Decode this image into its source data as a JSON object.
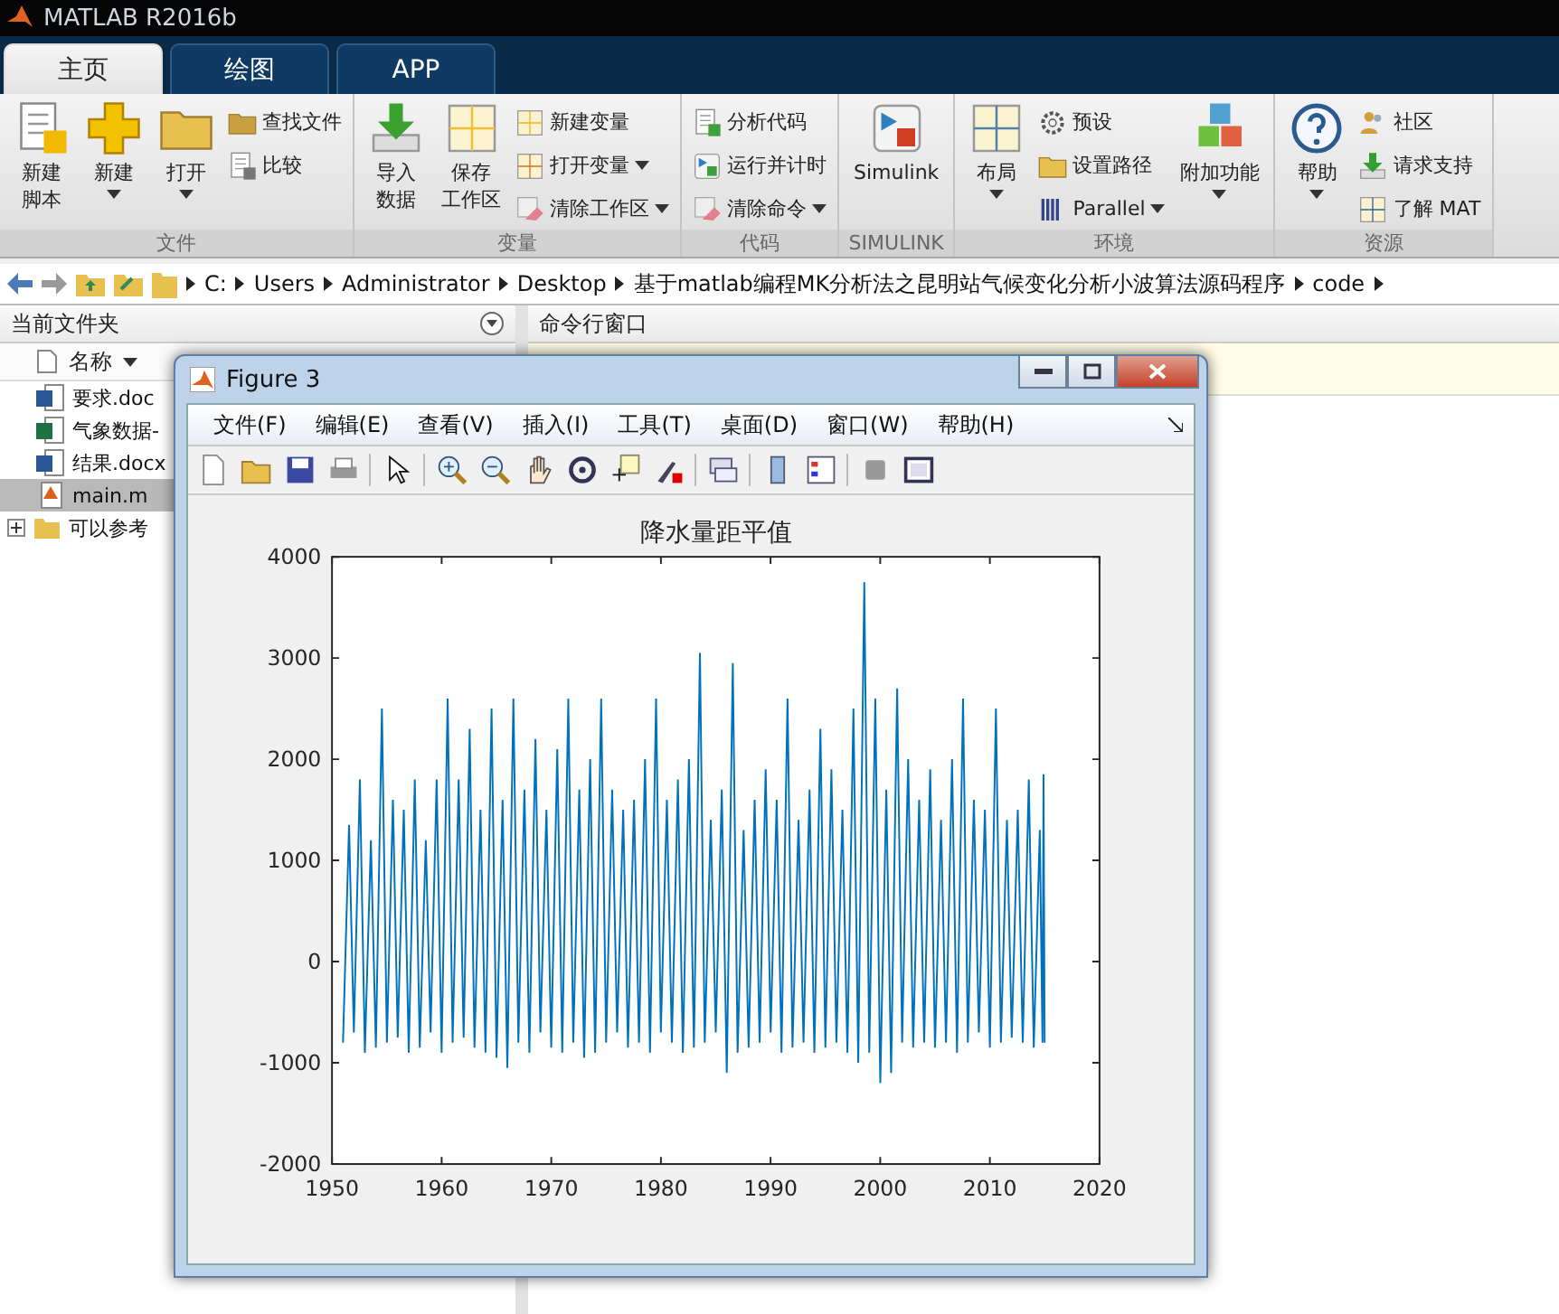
{
  "window": {
    "title": "MATLAB R2016b"
  },
  "tabs": [
    {
      "label": "主页",
      "selected": true
    },
    {
      "label": "绘图",
      "selected": false
    },
    {
      "label": "APP",
      "selected": false
    }
  ],
  "ribbon": [
    {
      "label": "文件",
      "columns": [
        {
          "kind": "large",
          "lines": [
            "新建",
            "脚本"
          ],
          "dropdown": false
        },
        {
          "kind": "large",
          "lines": [
            "新建"
          ],
          "dropdown": true
        },
        {
          "kind": "large",
          "lines": [
            "打开"
          ],
          "dropdown": true
        },
        {
          "kind": "stack",
          "items": [
            {
              "label": "查找文件",
              "dropdown": false
            },
            {
              "label": "比较",
              "dropdown": false
            }
          ]
        }
      ]
    },
    {
      "label": "变量",
      "columns": [
        {
          "kind": "large",
          "lines": [
            "导入",
            "数据"
          ],
          "dropdown": false
        },
        {
          "kind": "large",
          "lines": [
            "保存",
            "工作区"
          ],
          "dropdown": false
        },
        {
          "kind": "stack",
          "items": [
            {
              "label": "新建变量",
              "dropdown": false
            },
            {
              "label": "打开变量",
              "dropdown": true
            },
            {
              "label": "清除工作区",
              "dropdown": true
            }
          ]
        }
      ]
    },
    {
      "label": "代码",
      "columns": [
        {
          "kind": "stack",
          "items": [
            {
              "label": "分析代码",
              "dropdown": false
            },
            {
              "label": "运行并计时",
              "dropdown": false
            },
            {
              "label": "清除命令",
              "dropdown": true
            }
          ]
        }
      ]
    },
    {
      "label": "SIMULINK",
      "columns": [
        {
          "kind": "large",
          "lines": [
            "Simulink"
          ],
          "dropdown": false
        }
      ]
    },
    {
      "label": "环境",
      "columns": [
        {
          "kind": "large",
          "lines": [
            "布局"
          ],
          "dropdown": true
        },
        {
          "kind": "stack",
          "items": [
            {
              "label": "预设",
              "dropdown": false
            },
            {
              "label": "设置路径",
              "dropdown": false
            },
            {
              "label": "Parallel",
              "dropdown": true
            }
          ]
        },
        {
          "kind": "large",
          "lines": [
            "附加功能"
          ],
          "dropdown": true
        }
      ]
    },
    {
      "label": "资源",
      "columns": [
        {
          "kind": "large",
          "lines": [
            "帮助"
          ],
          "dropdown": true
        },
        {
          "kind": "stack",
          "items": [
            {
              "label": "社区",
              "dropdown": false
            },
            {
              "label": "请求支持",
              "dropdown": false
            },
            {
              "label": "了解 MAT",
              "dropdown": false
            }
          ]
        }
      ]
    }
  ],
  "address_bar": {
    "path": [
      "C:",
      "Users",
      "Administrator",
      "Desktop",
      "基于matlab编程MK分析法之昆明站气候变化分析小波算法源码程序",
      "code"
    ]
  },
  "current_folder": {
    "title": "当前文件夹",
    "column": "名称",
    "files": [
      {
        "name": "要求.doc",
        "kind": "word",
        "selected": false
      },
      {
        "name": "气象数据-",
        "kind": "excel",
        "selected": false
      },
      {
        "name": "结果.docx",
        "kind": "word",
        "selected": false
      },
      {
        "name": "main.m",
        "kind": "script",
        "selected": true
      },
      {
        "name": "可以参考",
        "kind": "folder",
        "selected": false,
        "expanded": false
      }
    ]
  },
  "command_window": {
    "title": "命令行窗口"
  },
  "figure": {
    "title": "Figure 3",
    "menu": [
      "文件(F)",
      "编辑(E)",
      "查看(V)",
      "插入(I)",
      "工具(T)",
      "桌面(D)",
      "窗口(W)",
      "帮助(H)"
    ],
    "chart_data": {
      "type": "line",
      "title": "降水量距平值",
      "xlim": [
        1950,
        2020
      ],
      "ylim": [
        -2000,
        4000
      ],
      "xticks": [
        1950,
        1960,
        1970,
        1980,
        1990,
        2000,
        2010,
        2020
      ],
      "yticks": [
        -2000,
        -1000,
        0,
        1000,
        2000,
        3000,
        4000
      ],
      "x": [
        1951,
        1951.55,
        1952,
        1952.55,
        1953,
        1953.55,
        1954,
        1954.55,
        1955,
        1955.55,
        1956,
        1956.55,
        1957,
        1957.55,
        1958,
        1958.55,
        1959,
        1959.55,
        1960,
        1960.55,
        1961,
        1961.55,
        1962,
        1962.55,
        1963,
        1963.55,
        1964,
        1964.55,
        1965,
        1965.55,
        1966,
        1966.55,
        1967,
        1967.55,
        1968,
        1968.55,
        1969,
        1969.55,
        1970,
        1970.55,
        1971,
        1971.55,
        1972,
        1972.55,
        1973,
        1973.55,
        1974,
        1974.55,
        1975,
        1975.55,
        1976,
        1976.55,
        1977,
        1977.55,
        1978,
        1978.55,
        1979,
        1979.55,
        1980,
        1980.55,
        1981,
        1981.55,
        1982,
        1982.55,
        1983,
        1983.55,
        1984,
        1984.55,
        1985,
        1985.55,
        1986,
        1986.55,
        1987,
        1987.55,
        1988,
        1988.55,
        1989,
        1989.55,
        1990,
        1990.55,
        1991,
        1991.55,
        1992,
        1992.55,
        1993,
        1993.55,
        1994,
        1994.55,
        1995,
        1995.55,
        1996,
        1996.55,
        1997,
        1997.55,
        1998,
        1998.55,
        1999,
        1999.55,
        2000,
        2000.55,
        2001,
        2001.55,
        2002,
        2002.55,
        2003,
        2003.55,
        2004,
        2004.55,
        2005,
        2005.55,
        2006,
        2006.55,
        2007,
        2007.55,
        2008,
        2008.55,
        2009,
        2009.55,
        2010,
        2010.55,
        2011,
        2011.55,
        2012,
        2012.55,
        2013,
        2013.55,
        2014,
        2014.55,
        2014.8,
        2014.9,
        2015
      ],
      "series": [
        {
          "color": "#0072bd",
          "values": [
            -800,
            1350,
            -700,
            1800,
            -900,
            1200,
            -850,
            2500,
            -800,
            1600,
            -750,
            1500,
            -900,
            1800,
            -850,
            1200,
            -700,
            1800,
            -900,
            2600,
            -800,
            1800,
            -750,
            2300,
            -850,
            1500,
            -900,
            2500,
            -950,
            1600,
            -1050,
            2600,
            -800,
            1700,
            -900,
            2200,
            -700,
            1500,
            -850,
            2100,
            -900,
            2600,
            -800,
            1700,
            -950,
            2000,
            -900,
            2600,
            -800,
            1700,
            -700,
            1500,
            -850,
            1600,
            -800,
            2000,
            -900,
            2600,
            -700,
            1600,
            -800,
            1800,
            -900,
            2000,
            -850,
            3050,
            -800,
            1400,
            -700,
            1700,
            -1100,
            2950,
            -900,
            1300,
            -850,
            1600,
            -800,
            1900,
            -700,
            1600,
            -900,
            2600,
            -850,
            1400,
            -800,
            1700,
            -900,
            2300,
            -850,
            1900,
            -800,
            1500,
            -900,
            2500,
            -1000,
            3750,
            -900,
            2600,
            -1200,
            1700,
            -1100,
            2700,
            -800,
            2000,
            -850,
            1600,
            -800,
            1900,
            -850,
            1400,
            -800,
            2000,
            -900,
            2600,
            -800,
            1600,
            -700,
            1500,
            -850,
            2500,
            -800,
            1400,
            -750,
            1500,
            -800,
            1800,
            -850,
            1300,
            -800,
            1850,
            -800
          ]
        }
      ]
    }
  }
}
